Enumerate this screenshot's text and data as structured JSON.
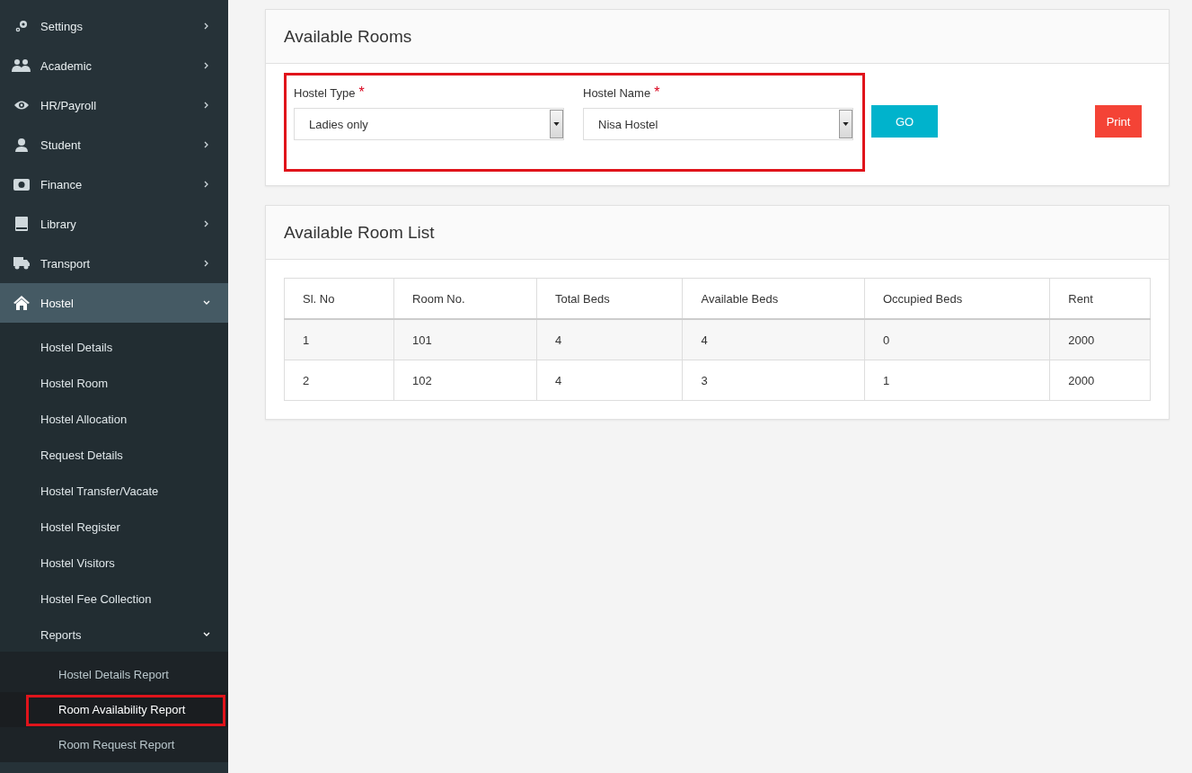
{
  "sidebar": {
    "items": [
      {
        "label": "Settings",
        "expanded": false
      },
      {
        "label": "Academic",
        "expanded": false
      },
      {
        "label": "HR/Payroll",
        "expanded": false
      },
      {
        "label": "Student",
        "expanded": false
      },
      {
        "label": "Finance",
        "expanded": false
      },
      {
        "label": "Library",
        "expanded": false
      },
      {
        "label": "Transport",
        "expanded": false
      },
      {
        "label": "Hostel",
        "expanded": true,
        "children": [
          {
            "label": "Hostel Details"
          },
          {
            "label": "Hostel Room"
          },
          {
            "label": "Hostel Allocation"
          },
          {
            "label": "Request Details"
          },
          {
            "label": "Hostel Transfer/Vacate"
          },
          {
            "label": "Hostel Register"
          },
          {
            "label": "Hostel Visitors"
          },
          {
            "label": "Hostel Fee Collection"
          },
          {
            "label": "Reports",
            "expanded": true,
            "children": [
              {
                "label": "Hostel Details Report",
                "selected": false,
                "highlighted": false
              },
              {
                "label": "Room Availability Report",
                "selected": true,
                "highlighted": true
              },
              {
                "label": "Room Request Report",
                "selected": false,
                "highlighted": false
              }
            ]
          }
        ]
      }
    ]
  },
  "filter_card": {
    "title": "Available Rooms",
    "highlighted": true,
    "fields": [
      {
        "label": "Hostel Type",
        "required_mark": "*",
        "value": "Ladies only"
      },
      {
        "label": "Hostel Name",
        "required_mark": "*",
        "value": "Nisa Hostel"
      }
    ],
    "go_button": "GO",
    "print_button": "Print"
  },
  "list_card": {
    "title": "Available Room List",
    "table": {
      "columns": [
        "Sl. No",
        "Room No.",
        "Total Beds",
        "Available Beds",
        "Occupied Beds",
        "Rent"
      ],
      "rows": [
        [
          "1",
          "101",
          "4",
          "4",
          "0",
          "2000"
        ],
        [
          "2",
          "102",
          "4",
          "3",
          "1",
          "2000"
        ]
      ]
    }
  }
}
